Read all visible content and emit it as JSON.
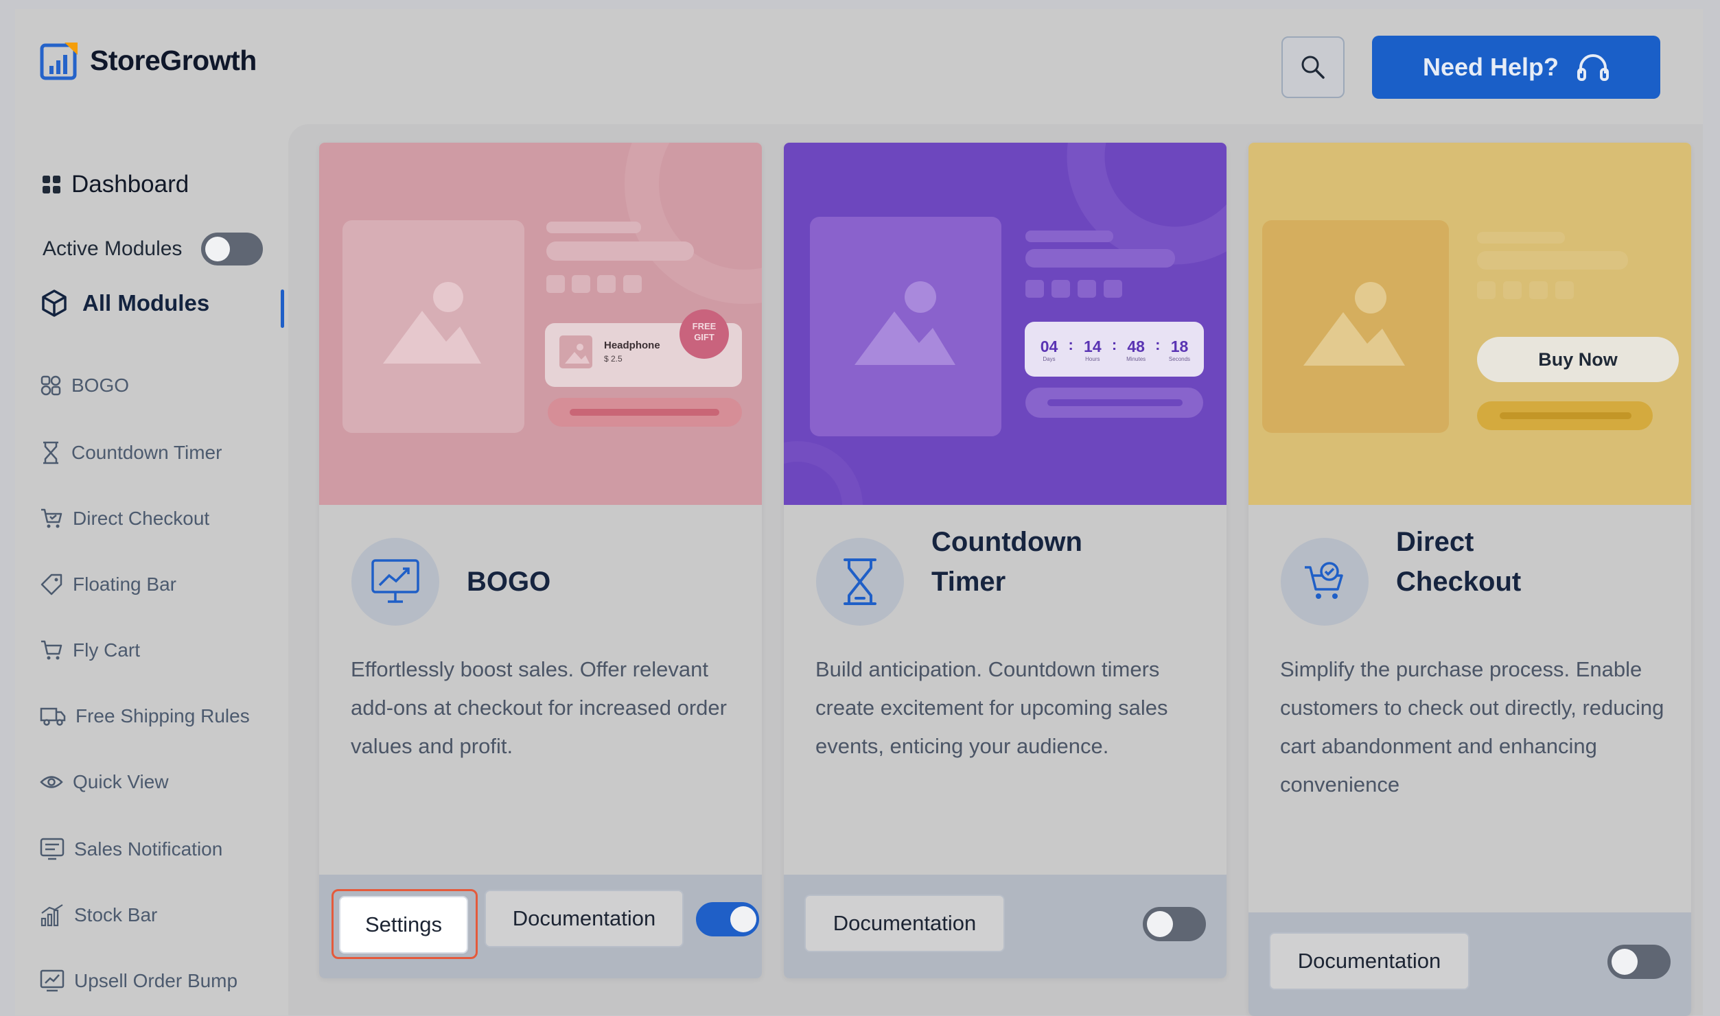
{
  "header": {
    "brand": "StoreGrowth",
    "help_label": "Need Help?"
  },
  "sidebar": {
    "dashboard": "Dashboard",
    "active_modules": {
      "label": "Active Modules",
      "on": false
    },
    "all_modules": "All Modules",
    "items": [
      {
        "label": "BOGO",
        "icon": "bogo-icon"
      },
      {
        "label": "Countdown Timer",
        "icon": "hourglass-icon"
      },
      {
        "label": "Direct Checkout",
        "icon": "cart-check-icon"
      },
      {
        "label": "Floating Bar",
        "icon": "tag-icon"
      },
      {
        "label": "Fly Cart",
        "icon": "cart-icon"
      },
      {
        "label": "Free Shipping Rules",
        "icon": "truck-icon"
      },
      {
        "label": "Quick View",
        "icon": "eye-icon"
      },
      {
        "label": "Sales Notification",
        "icon": "notification-icon"
      },
      {
        "label": "Stock Bar",
        "icon": "bar-chart-icon"
      },
      {
        "label": "Upsell Order Bump",
        "icon": "trend-icon"
      }
    ]
  },
  "cards": [
    {
      "title": "BOGO",
      "description": "Effortlessly boost sales. Offer relevant add-ons at checkout for increased order values and profit.",
      "settings_label": "Settings",
      "doc_label": "Documentation",
      "enabled": true,
      "hero": {
        "product_name": "Headphone",
        "product_price": "$ 2.5",
        "badge": "FREE GIFT",
        "color": "#cf9ba4"
      }
    },
    {
      "title": "Countdown Timer",
      "description": "Build anticipation. Countdown timers create excitement for upcoming sales events, enticing your audience.",
      "doc_label": "Documentation",
      "enabled": false,
      "hero": {
        "color": "#6d47be",
        "timer": [
          {
            "value": "04",
            "unit": "Days"
          },
          {
            "value": "14",
            "unit": "Hours"
          },
          {
            "value": "48",
            "unit": "Minutes"
          },
          {
            "value": "18",
            "unit": "Seconds"
          }
        ]
      }
    },
    {
      "title": "Direct Checkout",
      "description": "Simplify the purchase process. Enable customers to check out directly, reducing cart abandonment and enhancing convenience",
      "doc_label": "Documentation",
      "enabled": false,
      "hero": {
        "buy_label": "Buy Now",
        "color": "#d9be74"
      }
    }
  ],
  "colors": {
    "primary": "#1a5fc8",
    "highlight": "#e45a3b",
    "title": "#16243f"
  }
}
